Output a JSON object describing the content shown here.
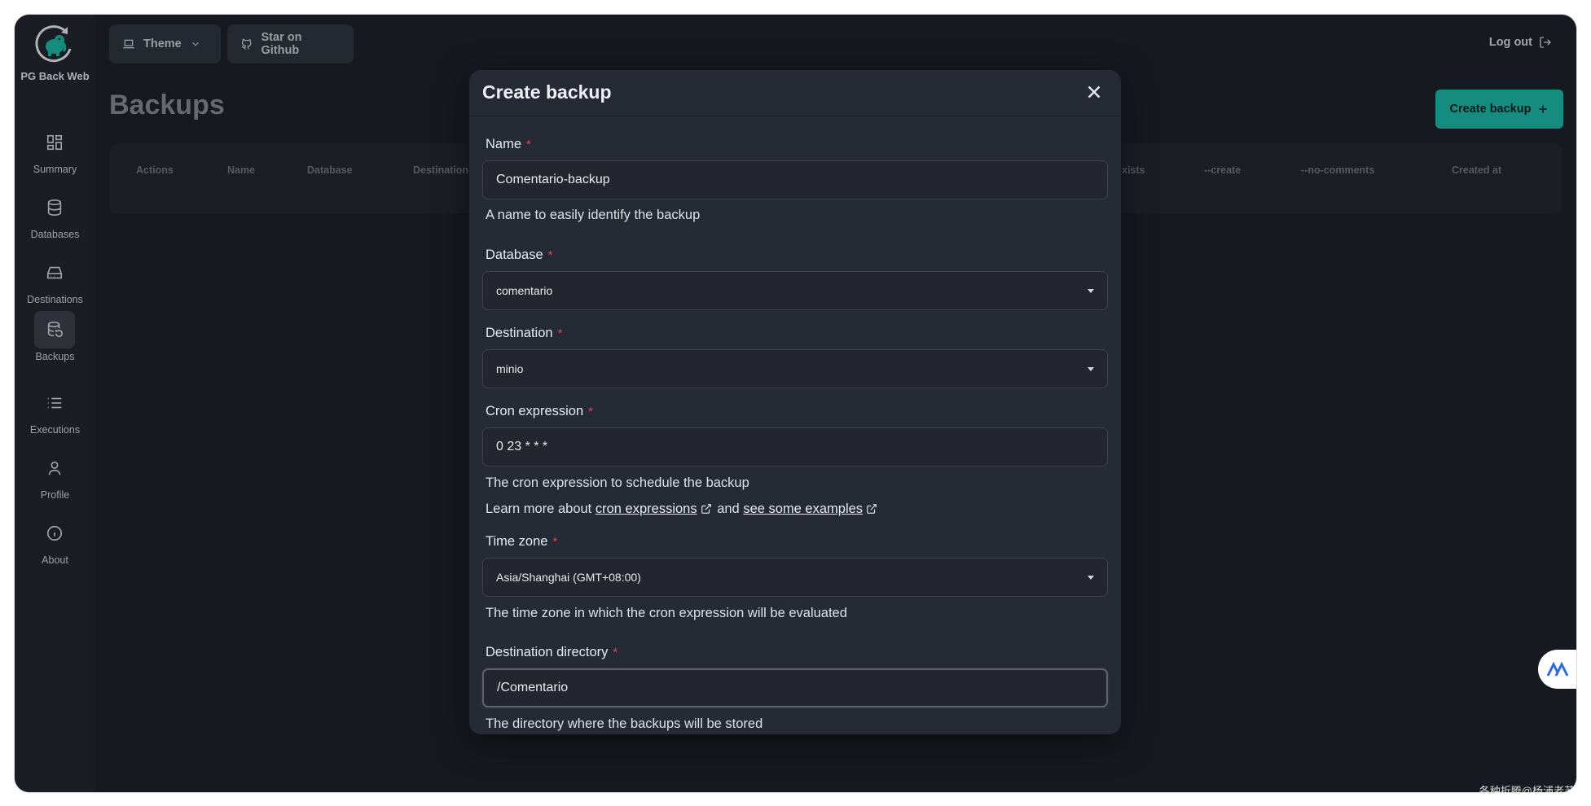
{
  "sidebar": {
    "brand": "PG Back Web",
    "items": [
      {
        "label": "Summary",
        "icon": "grid-icon"
      },
      {
        "label": "Databases",
        "icon": "database-icon"
      },
      {
        "label": "Destinations",
        "icon": "hard-drive-icon"
      },
      {
        "label": "Backups",
        "icon": "database-restore-icon"
      },
      {
        "label": "Executions",
        "icon": "list-icon"
      },
      {
        "label": "Profile",
        "icon": "user-icon"
      },
      {
        "label": "About",
        "icon": "info-icon"
      }
    ]
  },
  "topbar": {
    "theme_label": "Theme",
    "github_label": "Star on Github",
    "logout_label": "Log out"
  },
  "page": {
    "title": "Backups",
    "create_button": "Create backup"
  },
  "table": {
    "headers": [
      "Actions",
      "Name",
      "Database",
      "Destination",
      "xists",
      "--create",
      "--no-comments",
      "Created at"
    ]
  },
  "modal": {
    "title": "Create backup",
    "name": {
      "label": "Name",
      "value": "Comentario-backup",
      "help": "A name to easily identify the backup"
    },
    "database": {
      "label": "Database",
      "value": "comentario"
    },
    "destination": {
      "label": "Destination",
      "value": "minio"
    },
    "cron": {
      "label": "Cron expression",
      "value": "0 23 * * *",
      "help": "The cron expression to schedule the backup",
      "learn_prefix": "Learn more about",
      "link1": "cron expressions",
      "and": "and",
      "link2": "see some examples"
    },
    "timezone": {
      "label": "Time zone",
      "value": "Asia/Shanghai (GMT+08:00)",
      "help": "The time zone in which the cron expression will be evaluated"
    },
    "dest_dir": {
      "label": "Destination directory",
      "value": "/Comentario",
      "help": "The directory where the backups will be stored"
    },
    "required_mark": "*"
  },
  "watermark": "各种折腾@杨浦老苏",
  "colors": {
    "accent": "#17b8a6",
    "background": "#1b1e26",
    "modal": "#262a34",
    "required": "#e0464b"
  }
}
